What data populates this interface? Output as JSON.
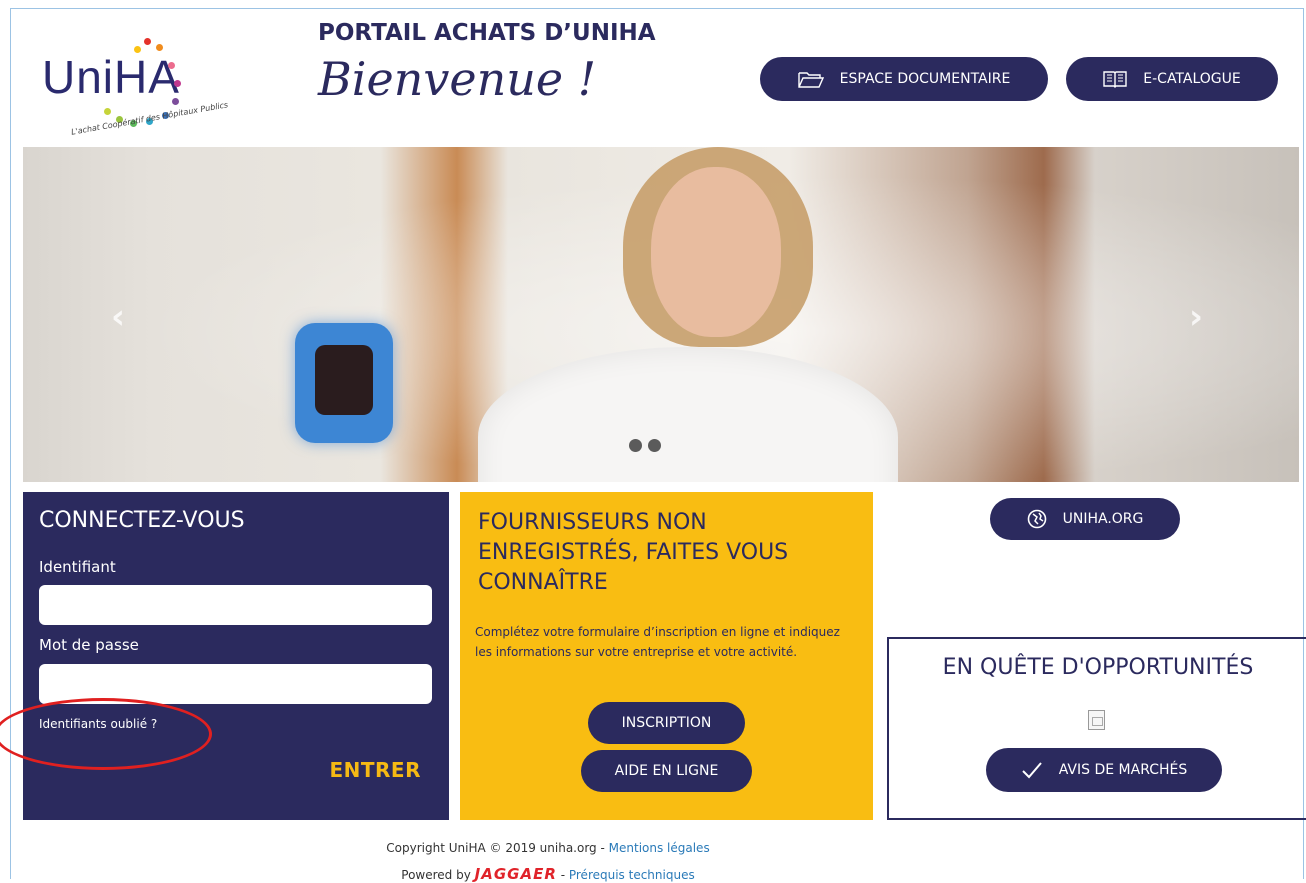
{
  "header": {
    "logo_text": "UniHA",
    "logo_subtitle": "L'achat Coopératif des Hôpitaux Publics",
    "portal_title": "PORTAIL ACHATS D’UNIHA",
    "welcome": "Bienvenue !",
    "doc_button": "ESPACE DOCUMENTAIRE",
    "catalog_button": "E-CATALOGUE",
    "doc_icon": "folder-icon",
    "catalog_icon": "book-icon"
  },
  "carousel": {
    "prev": "‹",
    "next": "›",
    "slide_count": 2
  },
  "login": {
    "title": "CONNECTEZ-VOUS",
    "username_label": "Identifiant",
    "username_value": "",
    "password_label": "Mot de passe",
    "password_value": "",
    "forgot": "Identifiants oublié ?",
    "submit": "ENTRER"
  },
  "suppliers": {
    "title": "FOURNISSEURS NON ENREGISTRÉS, FAITES VOUS CONNAÎTRE",
    "text": "Complétez votre formulaire d’inscription en ligne et indiquez les informations sur votre entreprise et votre activité.",
    "inscription": "INSCRIPTION",
    "aide": "AIDE EN LIGNE"
  },
  "right": {
    "uniha_button": "UNIHA.ORG",
    "uniha_icon": "globe-icon",
    "opportunities_title": "EN QUÊTE D'OPPORTUNITÉS",
    "avis_button": "AVIS DE MARCHÉS",
    "avis_icon": "checkmark-icon"
  },
  "footer": {
    "copyright": "Copyright UniHA © 2019 uniha.org - ",
    "mentions": "Mentions légales",
    "powered": "Powered by ",
    "brand": "JAGGAER",
    "separator": " - ",
    "prerequis": "Prérequis techniques"
  },
  "colors": {
    "navy": "#2b2a5e",
    "yellow": "#f9bd12",
    "accent_text": "#f5b914",
    "annotation_red": "#e02020"
  }
}
